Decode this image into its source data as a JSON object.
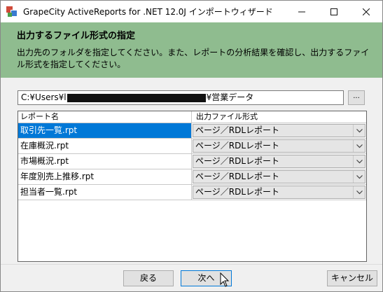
{
  "window": {
    "title": "GrapeCity ActiveReports for .NET 12.0J インポートウィザード",
    "minimize": "–",
    "maximize": "☐",
    "close": "✕"
  },
  "header": {
    "title": "出力するファイル形式の指定",
    "description": "出力先のフォルダを指定してください。また、レポートの分析結果を確認し、出力するファイル形式を指定してください。"
  },
  "path": {
    "prefix": "C:¥Users¥l",
    "suffix": "¥営業データ",
    "browse_label": "..."
  },
  "grid": {
    "columns": [
      "レポート名",
      "出力ファイル形式"
    ],
    "rows": [
      {
        "name": "取引先一覧.rpt",
        "format": "ページ／RDLレポート"
      },
      {
        "name": "在庫概況.rpt",
        "format": "ページ／RDLレポート"
      },
      {
        "name": "市場概況.rpt",
        "format": "ページ／RDLレポート"
      },
      {
        "name": "年度別売上推移.rpt",
        "format": "ページ／RDLレポート"
      },
      {
        "name": "担当者一覧.rpt",
        "format": "ページ／RDLレポート"
      }
    ]
  },
  "buttons": {
    "back": "戻る",
    "next": "次へ",
    "cancel": "キャンセル"
  }
}
